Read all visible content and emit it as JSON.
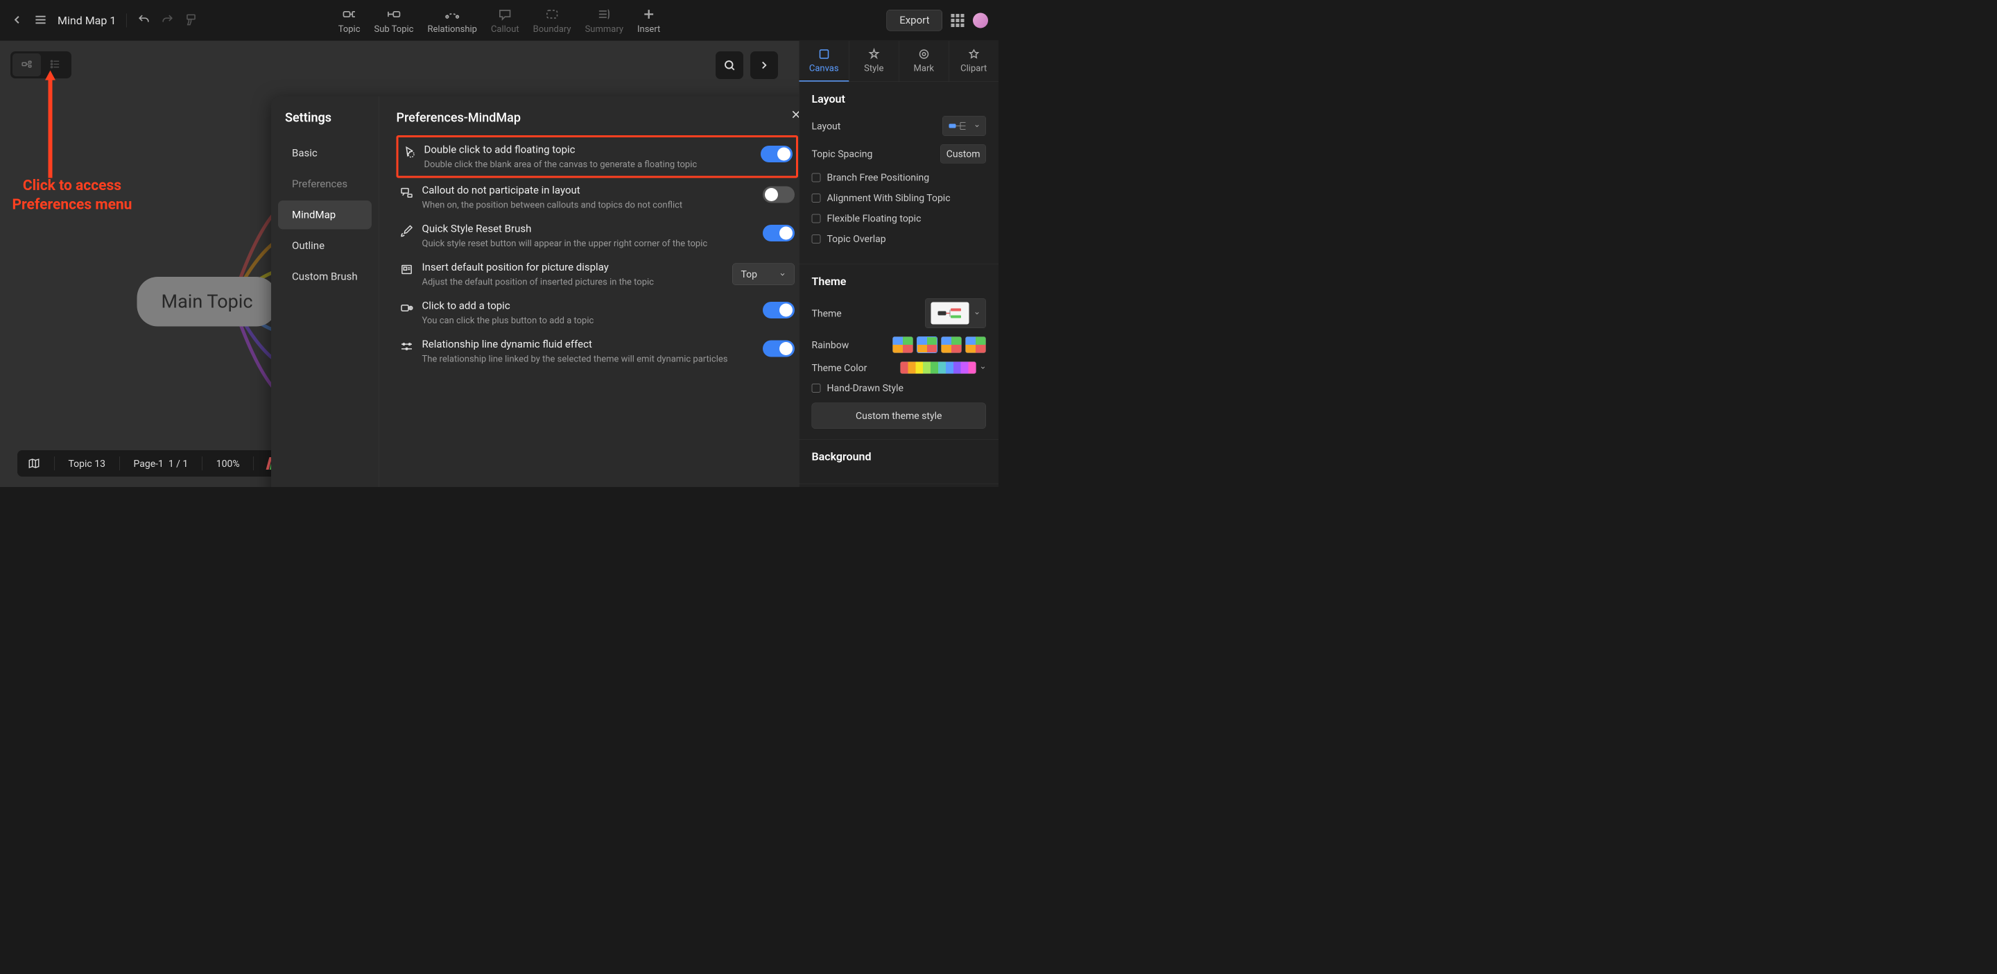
{
  "header": {
    "doc_title": "Mind Map 1",
    "toolbar_items": [
      {
        "id": "topic",
        "label": "Topic",
        "disabled": false
      },
      {
        "id": "subtopic",
        "label": "Sub Topic",
        "disabled": false
      },
      {
        "id": "relationship",
        "label": "Relationship",
        "disabled": false
      },
      {
        "id": "callout",
        "label": "Callout",
        "disabled": true
      },
      {
        "id": "boundary",
        "label": "Boundary",
        "disabled": true
      },
      {
        "id": "summary",
        "label": "Summary",
        "disabled": true
      },
      {
        "id": "insert",
        "label": "Insert",
        "disabled": false
      }
    ],
    "export_label": "Export"
  },
  "annotation": {
    "line1": "Click to access",
    "line2": "Preferences menu"
  },
  "canvas": {
    "main_topic": "Main Topic"
  },
  "settings_modal": {
    "title": "Settings",
    "content_title": "Preferences-MindMap",
    "nav": [
      {
        "label": "Basic",
        "active": false,
        "muted": false
      },
      {
        "label": "Preferences",
        "active": false,
        "muted": true
      },
      {
        "label": "MindMap",
        "active": true,
        "muted": false
      },
      {
        "label": "Outline",
        "active": false,
        "muted": false
      },
      {
        "label": "Custom Brush",
        "active": false,
        "muted": false
      }
    ],
    "prefs": [
      {
        "title": "Double click to add floating topic",
        "desc": "Double click the blank area of the canvas to generate a floating topic",
        "control": "toggle",
        "value": true,
        "highlighted": true
      },
      {
        "title": "Callout do not participate in layout",
        "desc": "When on, the position between callouts and topics do not conflict",
        "control": "toggle",
        "value": false
      },
      {
        "title": "Quick Style Reset Brush",
        "desc": "Quick style reset button will appear in the upper right corner of the topic",
        "control": "toggle",
        "value": true
      },
      {
        "title": "Insert default position for picture display",
        "desc": "Adjust the default position of inserted pictures in the topic",
        "control": "dropdown",
        "value": "Top"
      },
      {
        "title": "Click to add a topic",
        "desc": "You can click the plus button to add a topic",
        "control": "toggle",
        "value": true
      },
      {
        "title": "Relationship line dynamic fluid effect",
        "desc": "The relationship line linked by the selected theme will emit dynamic particles",
        "control": "toggle",
        "value": true
      }
    ]
  },
  "right_panel": {
    "tabs": [
      {
        "label": "Canvas",
        "active": true
      },
      {
        "label": "Style",
        "active": false
      },
      {
        "label": "Mark",
        "active": false
      },
      {
        "label": "Clipart",
        "active": false
      }
    ],
    "layout_section": {
      "title": "Layout",
      "layout_label": "Layout",
      "spacing_label": "Topic Spacing",
      "spacing_value": "Custom",
      "checks": [
        "Branch Free Positioning",
        "Alignment With Sibling Topic",
        "Flexible Floating topic",
        "Topic Overlap"
      ]
    },
    "theme_section": {
      "title": "Theme",
      "theme_label": "Theme",
      "rainbow_label": "Rainbow",
      "theme_color_label": "Theme Color",
      "hand_drawn_label": "Hand-Drawn Style",
      "custom_theme_btn": "Custom theme style",
      "color_strip": [
        "#e85d5d",
        "#f5a623",
        "#f5e623",
        "#a5e65b",
        "#5bc95b",
        "#5bc9c9",
        "#5b9cff",
        "#8a5bff",
        "#c85bff",
        "#ff5bc9"
      ]
    },
    "background_section": {
      "title": "Background"
    }
  },
  "bottom_bar": {
    "topic_count": "Topic 13",
    "page_label": "Page-1",
    "page_value": "1 / 1",
    "zoom": "100%"
  }
}
